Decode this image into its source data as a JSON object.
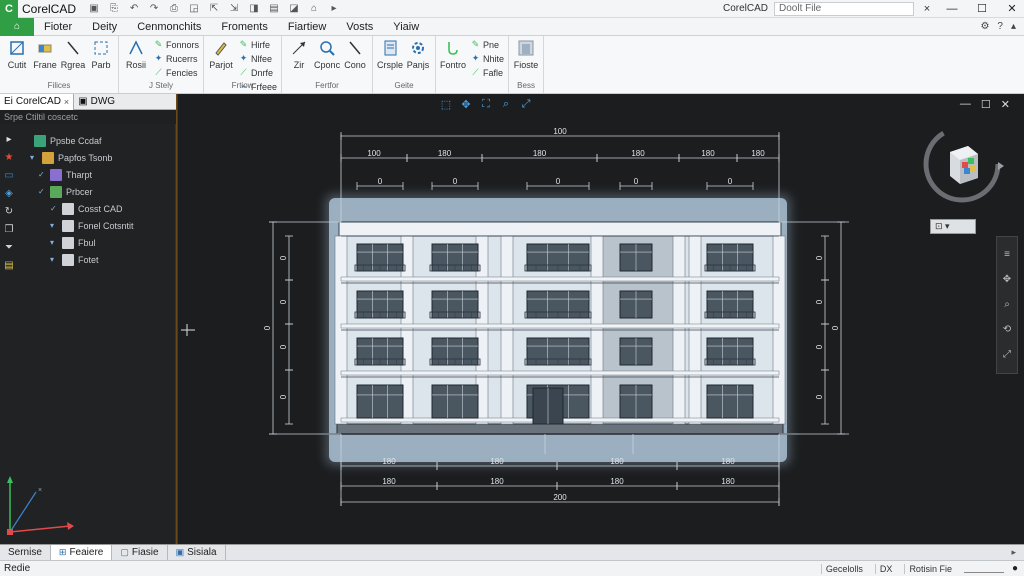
{
  "titlebar": {
    "logo": "C",
    "app_title": "CorelCAD",
    "quick_access": [
      "▣",
      "⎘",
      "↶",
      "↷",
      "⎙",
      "◲",
      "⇱",
      "⇲",
      "◨",
      "▤",
      "◪",
      "⌂",
      "▸"
    ],
    "file_name": "CorelCAD",
    "search_placeholder": "Doolt File",
    "search_clear": "×",
    "minimize": "—",
    "maximize": "☐",
    "close": "✕"
  },
  "menubar": {
    "home_label": "⌂",
    "items": [
      "Fioter",
      "Deity",
      "Cenmonchits",
      "Froments",
      "Fiartiew",
      "Vosts",
      "Yiaiw"
    ],
    "right_icons": [
      "⚙",
      "?",
      "▴"
    ]
  },
  "ribbon": {
    "groups": [
      {
        "label": "Filices",
        "tools": [
          {
            "label": "Cutit",
            "icon": "square-icon"
          },
          {
            "label": "Frane",
            "icon": "eraser-icon"
          },
          {
            "label": "Rgrea",
            "icon": "line-icon"
          },
          {
            "label": "Parb",
            "icon": "brackets-icon"
          }
        ],
        "minis": []
      },
      {
        "label": "J Stely",
        "tools": [
          {
            "label": "Rosii",
            "icon": "crane-icon"
          }
        ],
        "minis": [
          "Fonnors",
          "Rucerrs",
          "Fencies"
        ]
      },
      {
        "label": "Frtiow",
        "tools": [
          {
            "label": "Parjot",
            "icon": "pen-icon"
          }
        ],
        "minis": [
          "Hirfe",
          "Nlfee",
          "Dnrfe",
          "Frfeee"
        ]
      },
      {
        "label": "Fertfor",
        "tools": [
          {
            "label": "Zir",
            "icon": "arrows-icon"
          },
          {
            "label": "Cponc",
            "icon": "zoom-icon"
          },
          {
            "label": "Cono",
            "icon": "line-icon"
          }
        ],
        "minis": []
      },
      {
        "label": "Geite",
        "tools": [
          {
            "label": "Crsple",
            "icon": "doc-icon"
          },
          {
            "label": "Panjs",
            "icon": "gear-icon"
          }
        ],
        "minis": []
      },
      {
        "label": "",
        "tools": [
          {
            "label": "Fontro",
            "icon": "hook-icon"
          }
        ],
        "minis": [
          "Pne",
          "Nhite",
          "Fafle"
        ]
      },
      {
        "label": "Bess",
        "tools": [
          {
            "label": "Fioste",
            "icon": "layers-icon"
          }
        ],
        "minis": []
      }
    ]
  },
  "sidepanel": {
    "doc_tabs": [
      {
        "label": "CorelCAD",
        "prefix": "Ei",
        "close": "×"
      },
      {
        "label": "DWG",
        "prefix": "▣",
        "close": ""
      }
    ],
    "panel_title": "Srpe Ctiltil coscetc",
    "tree": [
      {
        "label": "Ppsbe Ccdaf",
        "indent": 2,
        "color": "#3aa37a",
        "twist": ""
      },
      {
        "label": "Papfos Tsonb",
        "indent": 10,
        "color": "#d4a23a",
        "twist": "▾"
      },
      {
        "label": "Tharpt",
        "indent": 18,
        "color": "#8b6fd0",
        "twist": "✓"
      },
      {
        "label": "Prbcer",
        "indent": 18,
        "color": "#5aa85a",
        "twist": "✓"
      },
      {
        "label": "Cosst CAD",
        "indent": 30,
        "color": "#cfd3d8",
        "twist": "✓"
      },
      {
        "label": "Fonel Cotsntit",
        "indent": 30,
        "color": "#cfd3d8",
        "twist": "▾"
      },
      {
        "label": "Fbul",
        "indent": 30,
        "color": "#cfd3d8",
        "twist": "▾"
      },
      {
        "label": "Fotet",
        "indent": 30,
        "color": "#cfd3d8",
        "twist": "▾"
      }
    ]
  },
  "canvas": {
    "toolbar_icons": [
      "⬚",
      "✥",
      "⛶",
      "⌕",
      "⤢"
    ],
    "win_buttons": [
      "—",
      "☐",
      "✕"
    ],
    "view_dropdown": "⊡ ▾",
    "nav_icons": [
      "≡",
      "✥",
      "⌕",
      "⟲",
      "⤢"
    ],
    "dim_top_overall": "100",
    "dim_top_segments": [
      "100",
      "180",
      "180",
      "180",
      "180",
      "180"
    ],
    "dim_top_small": [
      "0",
      "0",
      "0",
      "0",
      "0"
    ],
    "dim_bottom_row1": [
      "180",
      "180",
      "180",
      "180"
    ],
    "dim_bottom_row2": [
      "180",
      "180",
      "180",
      "180"
    ],
    "dim_bottom_overall": "200",
    "dim_left": [
      "0",
      "0",
      "0",
      "0",
      "0"
    ],
    "dim_right": [
      "0",
      "0",
      "0",
      "0",
      "0"
    ],
    "building_floors": 4,
    "window_bays": 6
  },
  "layout_tabs": {
    "tabs": [
      {
        "label": "Sernise",
        "icon": "",
        "active": false
      },
      {
        "label": "Feaiere",
        "icon": "⊞",
        "active": true
      },
      {
        "label": "Fiasie",
        "icon": "▢",
        "active": false
      },
      {
        "label": "Sisiala",
        "icon": "▣",
        "active": false
      }
    ],
    "right": "▸"
  },
  "statusbar": {
    "left": "Redie",
    "items": [
      "Gecelolls",
      "DX",
      "Rotisin Fie"
    ],
    "slider_label": "—",
    "end": "●"
  },
  "colors": {
    "accent_green": "#2f9e44",
    "canvas_bg": "#1b1d1f",
    "drawing_line": "#c9d2da",
    "highlight": "#b9cde0"
  }
}
